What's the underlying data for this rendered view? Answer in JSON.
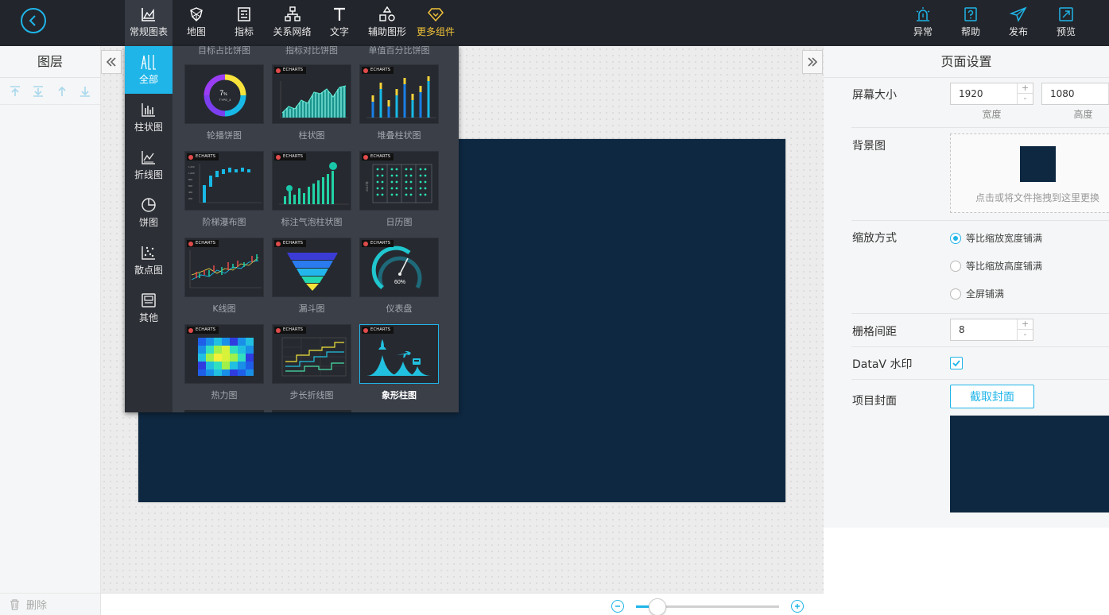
{
  "toolbar": {
    "items": [
      {
        "label": "常规图表",
        "icon": "area-chart-icon"
      },
      {
        "label": "地图",
        "icon": "map-icon"
      },
      {
        "label": "指标",
        "icon": "indicator-icon"
      },
      {
        "label": "关系网络",
        "icon": "network-icon"
      },
      {
        "label": "文字",
        "icon": "text-icon"
      },
      {
        "label": "辅助图形",
        "icon": "shapes-icon"
      },
      {
        "label": "更多组件",
        "icon": "diamond-icon"
      }
    ],
    "right": [
      {
        "label": "异常",
        "icon": "alarm-icon"
      },
      {
        "label": "帮助",
        "icon": "help-icon"
      },
      {
        "label": "发布",
        "icon": "publish-icon"
      },
      {
        "label": "预览",
        "icon": "preview-icon"
      }
    ]
  },
  "layers": {
    "title": "图层",
    "delete_label": "删除"
  },
  "categories": [
    {
      "label": "全部",
      "icon": "all-icon"
    },
    {
      "label": "柱状图",
      "icon": "bar-chart-icon"
    },
    {
      "label": "折线图",
      "icon": "line-chart-icon"
    },
    {
      "label": "饼图",
      "icon": "pie-chart-icon"
    },
    {
      "label": "散点图",
      "icon": "scatter-icon"
    },
    {
      "label": "其他",
      "icon": "other-icon"
    }
  ],
  "components": {
    "partial_top": [
      "目标占比饼图",
      "指标对比饼图",
      "单值百分比饼图"
    ],
    "badge": "ECHARTS",
    "items": [
      {
        "label": "轮播饼图"
      },
      {
        "label": "柱状图"
      },
      {
        "label": "堆叠柱状图"
      },
      {
        "label": "阶梯瀑布图"
      },
      {
        "label": "标注气泡柱状图"
      },
      {
        "label": "日历图"
      },
      {
        "label": "K线图"
      },
      {
        "label": "漏斗图"
      },
      {
        "label": "仪表盘"
      },
      {
        "label": "热力图"
      },
      {
        "label": "步长折线图"
      },
      {
        "label": "象形柱图",
        "selected": true
      }
    ],
    "thumb_texts": {
      "ring_value": "7",
      "ring_unit": "%",
      "ring_sub": "TYPE_4",
      "gauge_value": "60%",
      "calendar_year": "2017年"
    }
  },
  "settings": {
    "title": "页面设置",
    "screen_size": {
      "label": "屏幕大小",
      "width": "1920",
      "width_label": "宽度",
      "height": "1080",
      "height_label": "高度"
    },
    "background": {
      "label": "背景图",
      "hint": "点击或将文件拖拽到这里更换",
      "color": "#0e2841"
    },
    "scale": {
      "label": "缩放方式",
      "options": [
        "等比缩放宽度铺满",
        "等比缩放高度铺满",
        "全屏铺满"
      ],
      "selected_index": 0
    },
    "grid": {
      "label": "栅格间距",
      "value": "8"
    },
    "watermark": {
      "label": "DataV 水印",
      "checked": true
    },
    "cover": {
      "label": "项目封面",
      "button": "截取封面"
    }
  },
  "zoom": {
    "level": 0.15
  },
  "colors": {
    "accent": "#1fb5e8",
    "topbar": "#22252b",
    "gold": "#f2c33a",
    "screen": "#0e2841"
  }
}
